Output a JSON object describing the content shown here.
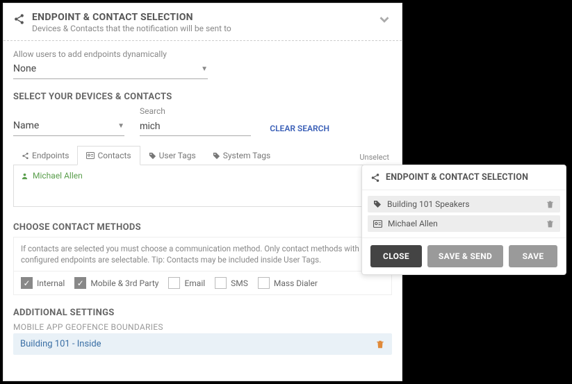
{
  "header": {
    "title": "ENDPOINT & CONTACT SELECTION",
    "subtitle": "Devices & Contacts that the notification will be sent to"
  },
  "dynamic": {
    "label": "Allow users to add endpoints dynamically",
    "value": "None"
  },
  "devices": {
    "heading": "SELECT YOUR DEVICES & CONTACTS",
    "filter_by": "Name",
    "search_label": "Search",
    "search_value": "mich",
    "clear": "CLEAR SEARCH",
    "unselect": "Unselect"
  },
  "tabs": {
    "endpoints": "Endpoints",
    "contacts": "Contacts",
    "user_tags": "User Tags",
    "system_tags": "System Tags"
  },
  "results": {
    "item1": "Michael Allen"
  },
  "methods": {
    "heading": "CHOOSE CONTACT METHODS",
    "hint": "If contacts are selected you must choose a communication method. Only contact methods with configured endpoints are selectable. Tip: Contacts may be included inside User Tags.",
    "internal": "Internal",
    "mobile": "Mobile & 3rd Party",
    "email": "Email",
    "sms": "SMS",
    "mass": "Mass Dialer"
  },
  "additional": {
    "heading": "ADDITIONAL SETTINGS",
    "sub": "MOBILE APP GEOFENCE BOUNDARIES",
    "geofence": "Building 101 - Inside"
  },
  "popup": {
    "title": "ENDPOINT & CONTACT SELECTION",
    "item1": "Building 101 Speakers",
    "item2": "Michael Allen",
    "close": "CLOSE",
    "send": "SAVE & SEND",
    "save": "SAVE"
  }
}
